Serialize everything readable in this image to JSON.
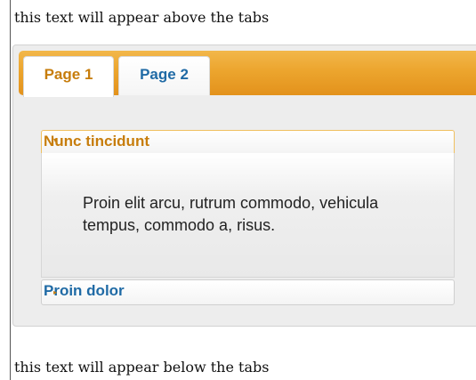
{
  "top_text": "this text will appear above the tabs",
  "bottom_text": "this text will appear below the tabs",
  "tabs": [
    {
      "label": "Page 1",
      "active": true
    },
    {
      "label": "Page 2",
      "active": false
    }
  ],
  "accordion": [
    {
      "title": "Nunc tincidunt",
      "expanded": true,
      "content": "Proin elit arcu, rutrum commodo, vehicula tempus, commodo a, risus."
    },
    {
      "title": "Proin dolor",
      "expanded": false
    }
  ],
  "colors": {
    "accent": "#e8a130",
    "active_text": "#c77d0c",
    "link_text": "#1f6aa5"
  }
}
